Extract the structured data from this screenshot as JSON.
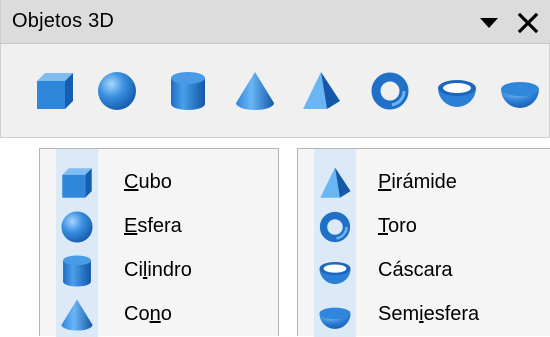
{
  "window": {
    "title": "Objetos 3D",
    "menu_icon": "triangle-down-icon",
    "close_icon": "close-icon"
  },
  "toolbar": {
    "buttons": [
      {
        "name": "Cubo",
        "icon": "cube-icon"
      },
      {
        "name": "Esfera",
        "icon": "sphere-icon"
      },
      {
        "name": "Cilindro",
        "icon": "cylinder-icon"
      },
      {
        "name": "Cono",
        "icon": "cone-icon"
      },
      {
        "name": "Pirámide",
        "icon": "pyramid-icon"
      },
      {
        "name": "Toro",
        "icon": "torus-icon"
      },
      {
        "name": "Cáscara",
        "icon": "shell-icon"
      },
      {
        "name": "Semiesfera",
        "icon": "half-sphere-icon"
      }
    ]
  },
  "menu_left": {
    "items": [
      {
        "label": "Cubo",
        "accel": "C",
        "rest": "ubo",
        "icon": "cube-icon"
      },
      {
        "label": "Esfera",
        "accel": "E",
        "rest": "sfera",
        "icon": "sphere-icon"
      },
      {
        "label": "Cilindro",
        "pre": "Ci",
        "accel": "l",
        "rest": "indro",
        "icon": "cylinder-icon"
      },
      {
        "label": "Cono",
        "pre": "Co",
        "accel": "n",
        "rest": "o",
        "icon": "cone-icon"
      }
    ]
  },
  "menu_right": {
    "items": [
      {
        "label": "Pirámide",
        "accel": "P",
        "rest": "irámide",
        "icon": "pyramid-icon"
      },
      {
        "label": "Toro",
        "accel": "T",
        "rest": "oro",
        "icon": "torus-icon"
      },
      {
        "label": "Cáscara",
        "pre": "",
        "accel": "",
        "rest": "Cáscara",
        "icon": "shell-icon"
      },
      {
        "label": "Semiesfera",
        "pre": "Sem",
        "accel": "i",
        "rest": "esfera",
        "icon": "half-sphere-icon"
      }
    ]
  },
  "colors": {
    "icon_light": "#7fbdf0",
    "icon_mid": "#2f86db",
    "icon_dark": "#155fb2",
    "highlight_gutter": "#dce9f7"
  }
}
